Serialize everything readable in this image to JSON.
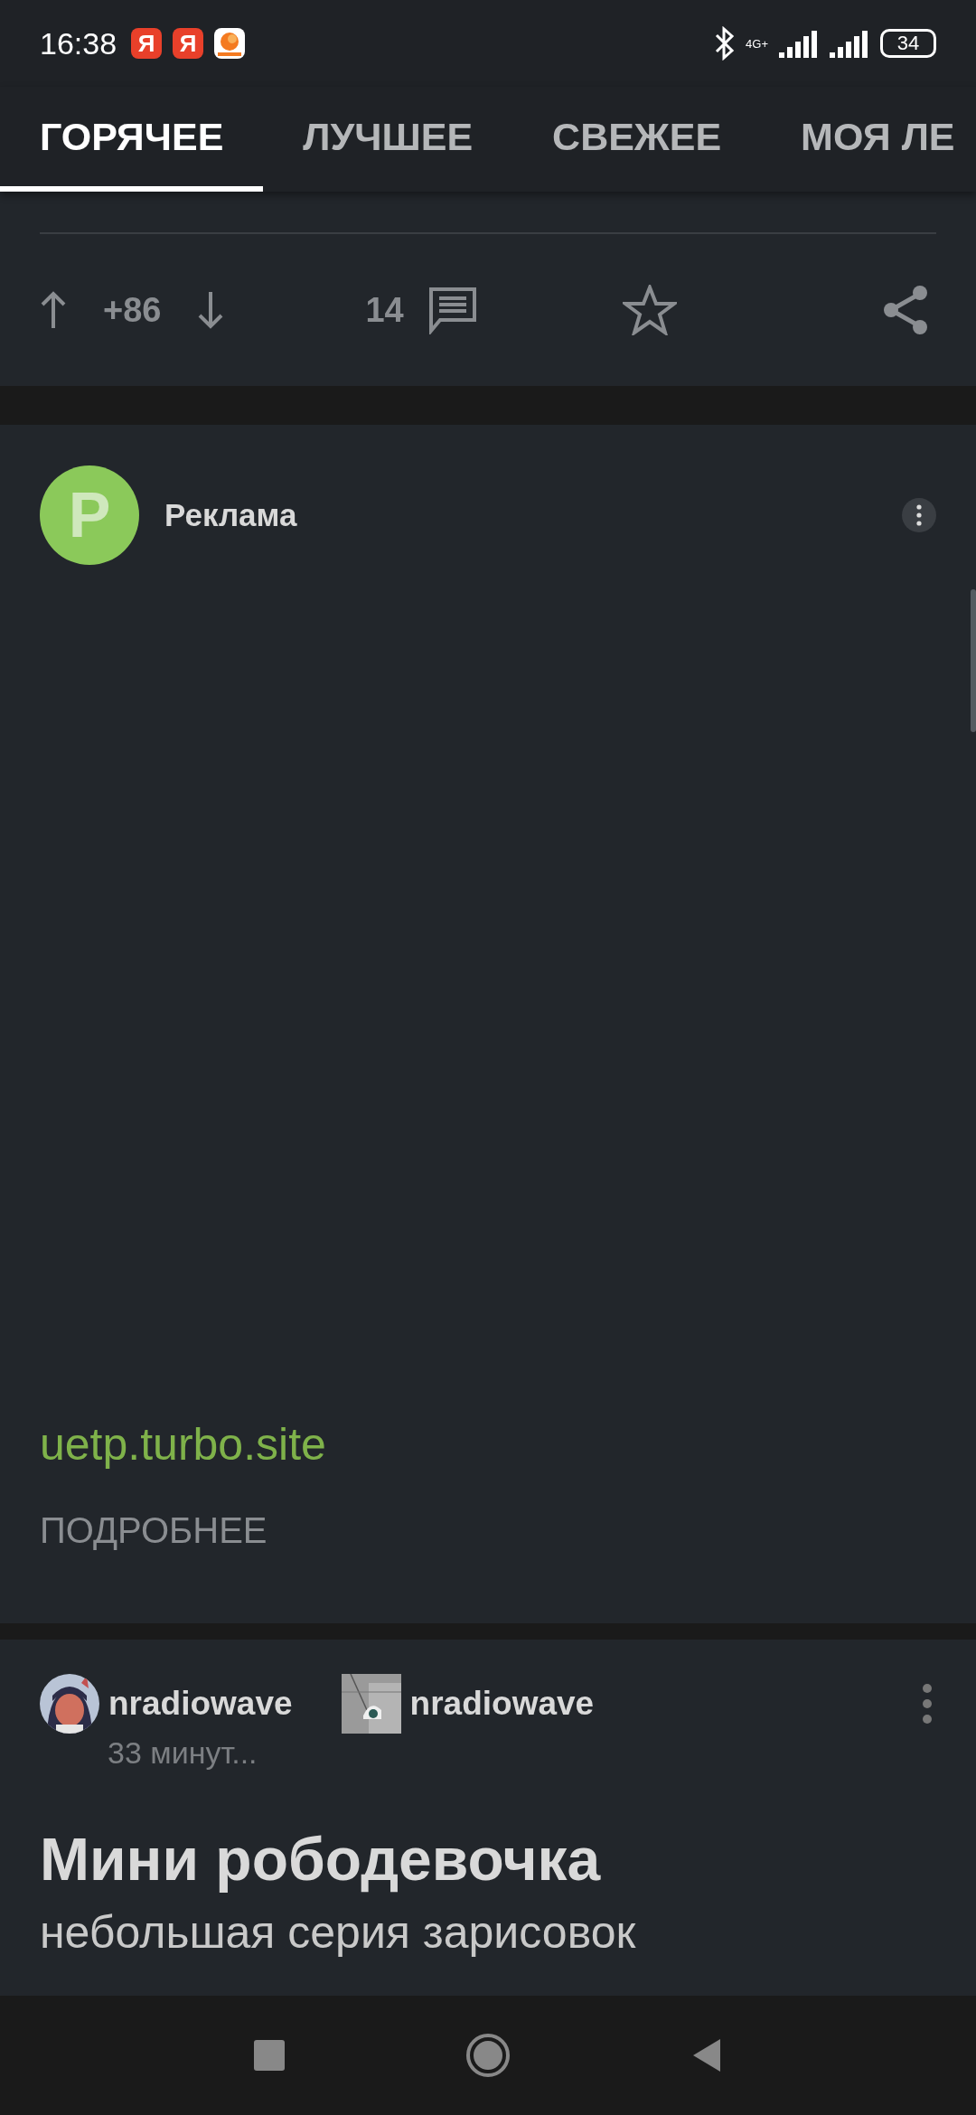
{
  "status_bar": {
    "time": "16:38",
    "app_icons": [
      {
        "kind": "letter",
        "label": "Я"
      },
      {
        "kind": "letter",
        "label": "Я"
      },
      {
        "kind": "orange"
      }
    ],
    "network": "4G+",
    "battery": "34"
  },
  "tabs": [
    {
      "label": "ГОРЯЧЕЕ",
      "selected": true
    },
    {
      "label": "ЛУЧШЕЕ",
      "selected": false
    },
    {
      "label": "СВЕЖЕЕ",
      "selected": false
    },
    {
      "label": "МОЯ ЛЕ",
      "selected": false
    }
  ],
  "post_actions": {
    "rating": "+86",
    "comments": "14"
  },
  "ad": {
    "avatar_letter": "P",
    "title": "Реклама",
    "link": "uetp.turbo.site",
    "button": "ПОДРОБНЕЕ"
  },
  "post": {
    "authors": [
      {
        "name": "nradiowave"
      },
      {
        "name": "nradiowave"
      }
    ],
    "time": "33 минут...",
    "title": "Мини рободевочка",
    "text": "небольшая серия зарисовок"
  }
}
